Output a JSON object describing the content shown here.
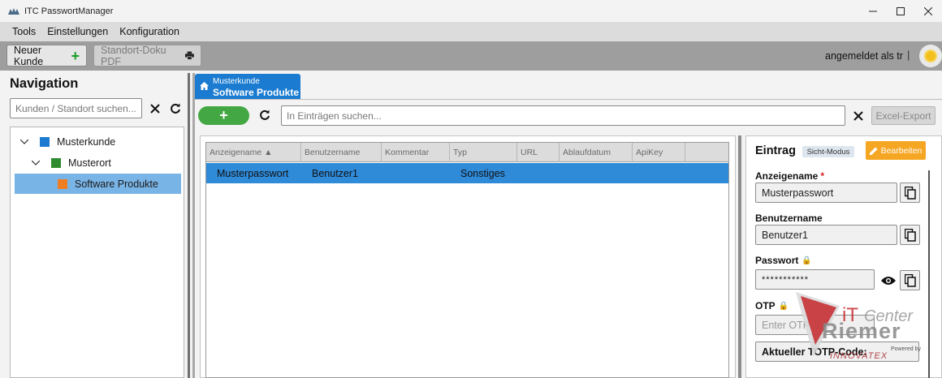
{
  "window": {
    "title": "ITC PasswortManager",
    "min_icon": "minimize-icon",
    "max_icon": "maximize-icon",
    "close_icon": "close-icon"
  },
  "menu": [
    "Tools",
    "Einstellungen",
    "Konfiguration"
  ],
  "toolbar": {
    "new_customer_label": "Neuer Kunde",
    "doku_label": "Standort-Doku PDF",
    "login_text": "angemeldet als tr",
    "separator": "|"
  },
  "nav": {
    "title": "Navigation",
    "search_placeholder": "Kunden / Standort suchen...",
    "tree": [
      {
        "label": "Musterkunde",
        "color": "#1a7bd0",
        "level": 0,
        "expanded": true
      },
      {
        "label": "Musterort",
        "color": "#2e8b2e",
        "level": 1,
        "expanded": true
      },
      {
        "label": "Software Produkte",
        "color": "#ef7d22",
        "level": 2,
        "selected": true
      }
    ]
  },
  "tab": {
    "sub": "Musterkunde",
    "main": "Software Produkte"
  },
  "entries": {
    "search_placeholder": "In Einträgen suchen...",
    "excel_label": "Excel-Export",
    "columns": [
      "Anzeigename ▲",
      "Benutzername",
      "Kommentar",
      "Typ",
      "URL",
      "Ablaufdatum",
      "ApiKey"
    ],
    "rows": [
      {
        "name": "Musterpasswort",
        "user": "Benutzer1",
        "comment": "",
        "type": "Sonstiges",
        "url": "",
        "expiry": "",
        "apikey": ""
      }
    ]
  },
  "detail": {
    "title": "Eintrag",
    "mode": "Sicht-Modus",
    "edit_label": "Bearbeiten",
    "fields": {
      "name_label": "Anzeigename",
      "name_required": "*",
      "name_value": "Musterpasswort",
      "user_label": "Benutzername",
      "user_value": "Benutzer1",
      "password_label": "Passwort",
      "password_value": "***********",
      "otp_label": "OTP",
      "otp_placeholder": "Enter OTP",
      "totp_label": "Aktueller TOTP-Code:"
    }
  },
  "watermark": {
    "it": "iT",
    "center": "Center",
    "riemer": "Riemer",
    "powered": "Powered by",
    "innovate": "INNOVATEX"
  },
  "colors": {
    "accent": "#1a7bd0",
    "add_green": "#43a843",
    "edit_orange": "#f5a623",
    "selection": "#2f8ad8"
  }
}
